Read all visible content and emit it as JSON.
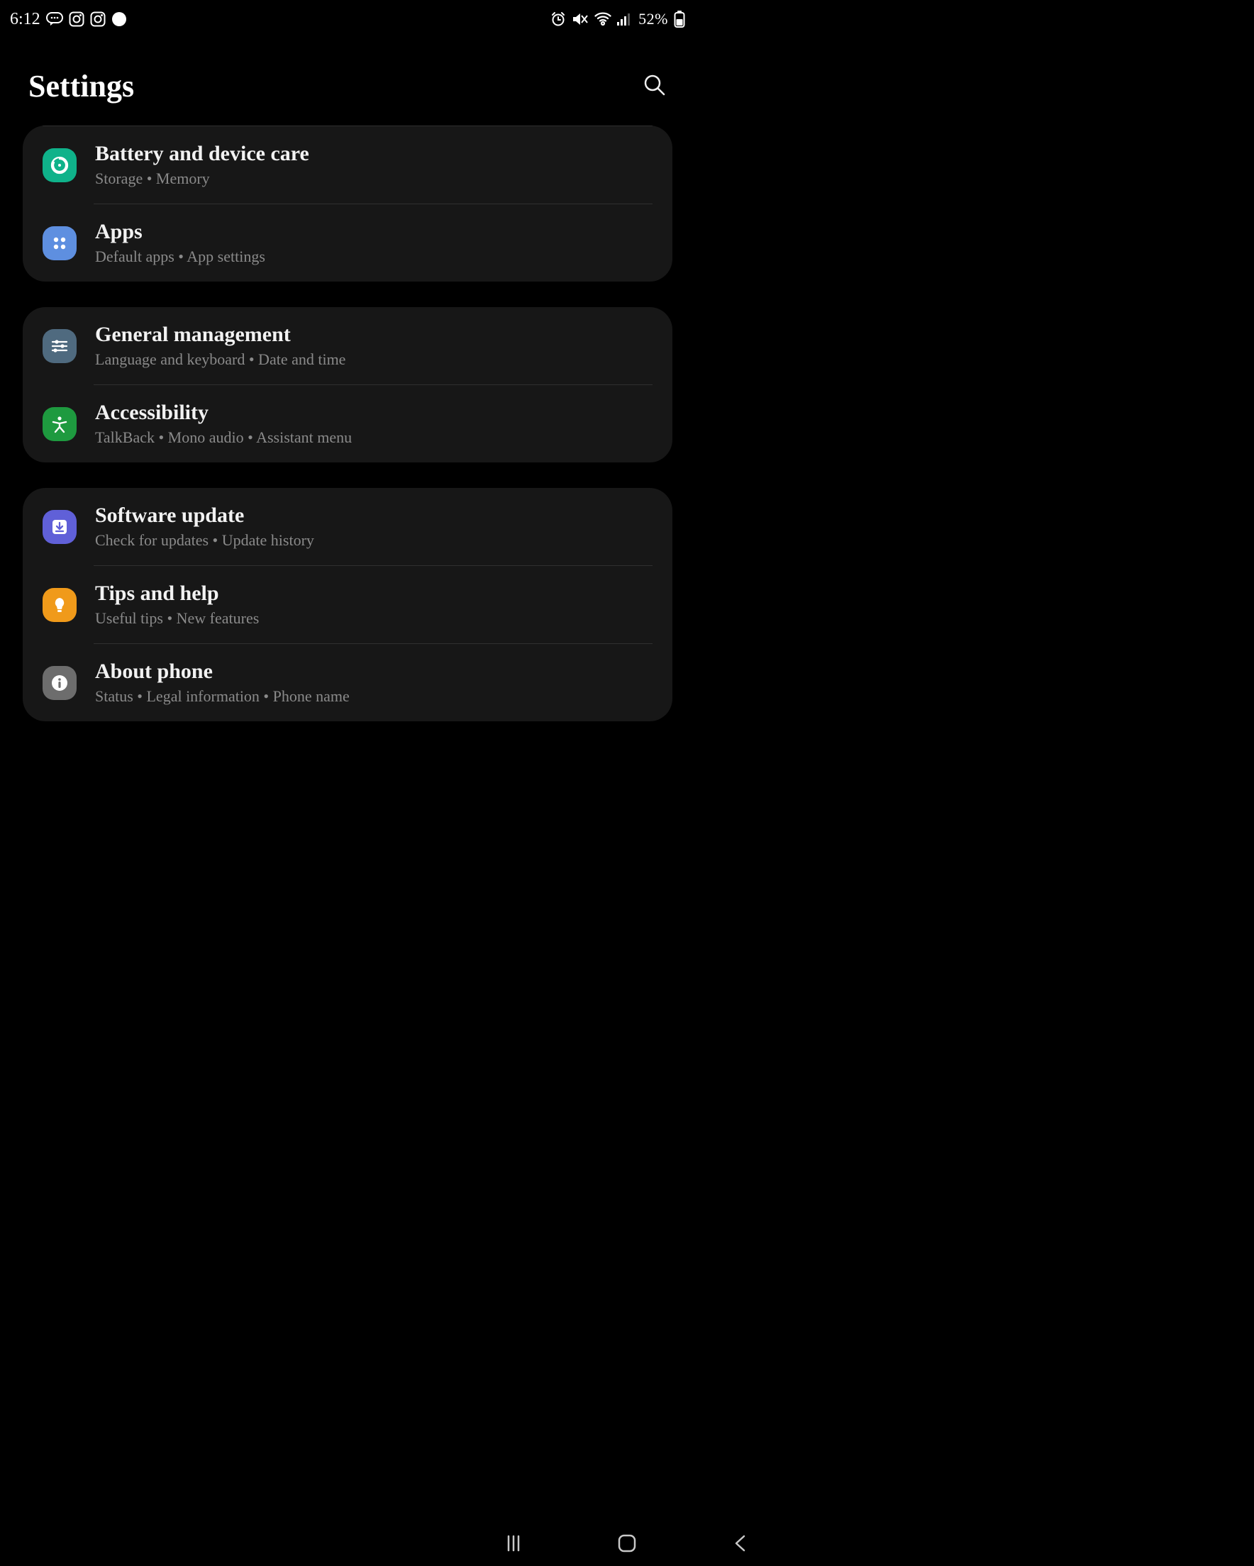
{
  "statusbar": {
    "time": "6:12",
    "battery": "52%"
  },
  "header": {
    "title": "Settings"
  },
  "groups": [
    {
      "top_divider": true,
      "items": [
        {
          "id": "battery",
          "title": "Battery and device care",
          "sub": "Storage  •  Memory",
          "icon_bg": "#0fb28a"
        },
        {
          "id": "apps",
          "title": "Apps",
          "sub": "Default apps  •  App settings",
          "icon_bg": "#5e8fe0"
        }
      ]
    },
    {
      "items": [
        {
          "id": "general",
          "title": "General management",
          "sub": "Language and keyboard  •  Date and time",
          "icon_bg": "#4f6a7f"
        },
        {
          "id": "access",
          "title": "Accessibility",
          "sub": "TalkBack  •  Mono audio  •  Assistant menu",
          "icon_bg": "#1e9a3f"
        }
      ]
    },
    {
      "items": [
        {
          "id": "update",
          "title": "Software update",
          "sub": "Check for updates  •  Update history",
          "icon_bg": "#6060d8"
        },
        {
          "id": "tips",
          "title": "Tips and help",
          "sub": "Useful tips  •  New features",
          "icon_bg": "#f09a1a"
        },
        {
          "id": "about",
          "title": "About phone",
          "sub": "Status  •  Legal information  •  Phone name",
          "icon_bg": "#6d6d6d"
        }
      ]
    }
  ]
}
